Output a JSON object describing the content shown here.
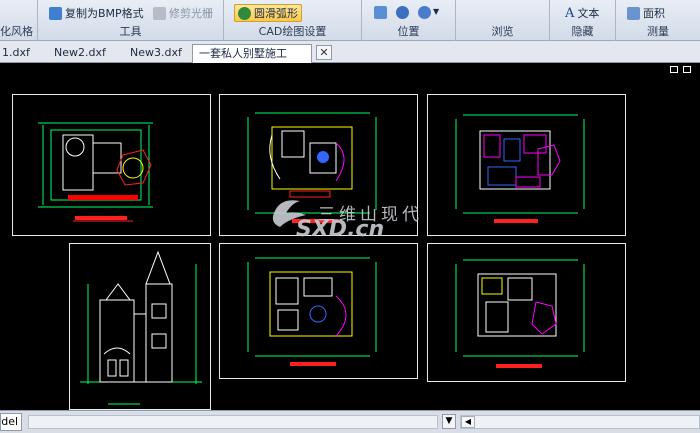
{
  "ribbon": {
    "groups": [
      {
        "label": "",
        "items": [
          "化风格"
        ]
      },
      {
        "label": "工具",
        "items": [
          "复制为BMP格式",
          "修剪光栅"
        ]
      },
      {
        "label": "CAD绘图设置",
        "items": [
          "圆滑弧形"
        ]
      },
      {
        "label": "位置",
        "items": []
      },
      {
        "label": "浏览",
        "items": []
      },
      {
        "label": "隐藏",
        "items": [
          "文本"
        ]
      },
      {
        "label": "测量",
        "items": [
          "面积"
        ]
      }
    ],
    "text_icon_glyph": "A"
  },
  "tabs": {
    "items": [
      "1.dxf",
      "New2.dxf",
      "New3.dxf",
      "一套私人别墅施工图.dwg"
    ],
    "active_index": 3,
    "close_glyph": "✕"
  },
  "watermark": {
    "cn": "三维山现代",
    "en": "SXD.cn"
  },
  "bottom": {
    "model_tab": "Model",
    "drop_glyph": "▼",
    "left_glyph": "◀"
  },
  "colors": {
    "accent": "#ffc94a",
    "canvas": "#000000",
    "dim_line": "#00ff66",
    "wall": "#ffffff",
    "red": "#ff2020",
    "magenta": "#ff00ff"
  }
}
